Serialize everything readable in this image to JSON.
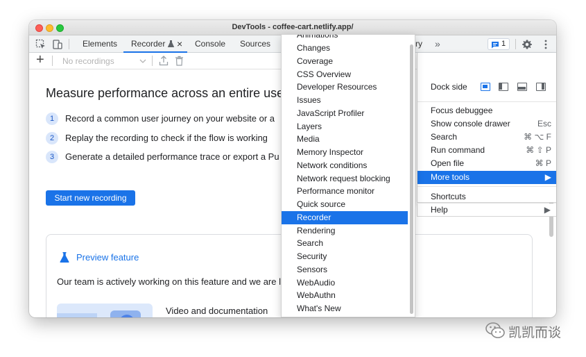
{
  "window": {
    "title": "DevTools - coffee-cart.netlify.app/"
  },
  "tabs": {
    "elements": "Elements",
    "recorder": "Recorder",
    "recorder_close": "×",
    "console": "Console",
    "sources": "Sources",
    "overflow_tail": "ry",
    "overflow_chevron": "»",
    "issues_count": "1"
  },
  "toolbar": {
    "add": "+",
    "recording_select": "No recordings"
  },
  "main": {
    "title": "Measure performance across an entire use",
    "steps": [
      {
        "num": "1",
        "text": "Record a common user journey on your website or a"
      },
      {
        "num": "2",
        "text": "Replay the recording to check if the flow is working"
      },
      {
        "num": "3",
        "text": "Generate a detailed performance trace or export a Pu"
      }
    ],
    "start_button": "Start new recording",
    "card": {
      "preview_label": "Preview feature",
      "body": "Our team is actively working on this feature and we are lo",
      "video_label": "Video and documentation"
    }
  },
  "main_menu": {
    "dock_side": "Dock side",
    "items": [
      {
        "label": "Focus debuggee",
        "shortcut": ""
      },
      {
        "label": "Show console drawer",
        "shortcut": "Esc"
      },
      {
        "label": "Search",
        "shortcut": "⌘ ⌥ F"
      },
      {
        "label": "Run command",
        "shortcut": "⌘ ⇧ P"
      },
      {
        "label": "Open file",
        "shortcut": "⌘ P"
      },
      {
        "label": "More tools",
        "shortcut": "▶"
      }
    ],
    "shortcuts": "Shortcuts",
    "help": "Help",
    "help_arrow": "▶"
  },
  "more_tools": {
    "items": [
      "Animations",
      "Changes",
      "Coverage",
      "CSS Overview",
      "Developer Resources",
      "Issues",
      "JavaScript Profiler",
      "Layers",
      "Media",
      "Memory Inspector",
      "Network conditions",
      "Network request blocking",
      "Performance monitor",
      "Quick source",
      "Recorder",
      "Rendering",
      "Search",
      "Security",
      "Sensors",
      "WebAudio",
      "WebAuthn",
      "What's New"
    ],
    "selected": "Recorder"
  },
  "watermark": {
    "text": "凯凯而谈"
  },
  "colors": {
    "accent": "#1a73e8",
    "selection": "#1a73e8"
  }
}
